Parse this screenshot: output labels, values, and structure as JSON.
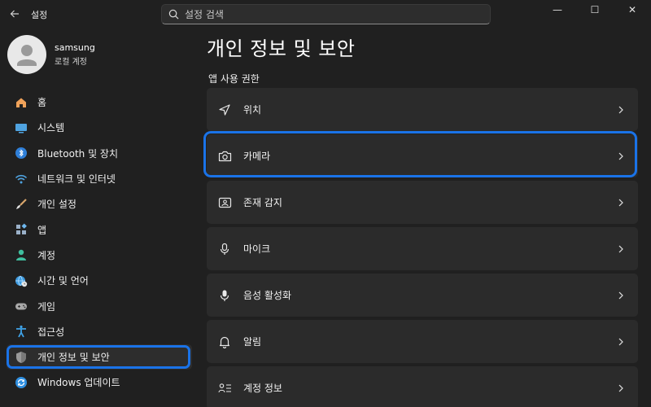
{
  "window": {
    "title": "설정",
    "minimize": "—",
    "maximize": "☐",
    "close": "✕"
  },
  "search": {
    "placeholder": "설정 검색"
  },
  "profile": {
    "name": "samsung",
    "account_type": "로컬 계정"
  },
  "sidebar": {
    "items": [
      {
        "label": "홈",
        "icon": "home-icon"
      },
      {
        "label": "시스템",
        "icon": "monitor-icon"
      },
      {
        "label": "Bluetooth 및 장치",
        "icon": "bluetooth-icon"
      },
      {
        "label": "네트워크 및 인터넷",
        "icon": "wifi-icon"
      },
      {
        "label": "개인 설정",
        "icon": "brush-icon"
      },
      {
        "label": "앱",
        "icon": "apps-icon"
      },
      {
        "label": "계정",
        "icon": "person-icon"
      },
      {
        "label": "시간 및 언어",
        "icon": "globe-clock-icon"
      },
      {
        "label": "게임",
        "icon": "gamepad-icon"
      },
      {
        "label": "접근성",
        "icon": "accessibility-icon"
      },
      {
        "label": "개인 정보 및 보안",
        "icon": "shield-icon",
        "active": true
      },
      {
        "label": "Windows 업데이트",
        "icon": "sync-icon"
      }
    ]
  },
  "main": {
    "title": "개인 정보 및 보안",
    "section": "앱 사용 권한",
    "rows": [
      {
        "label": "위치",
        "icon": "location-arrow-icon"
      },
      {
        "label": "카메라",
        "icon": "camera-icon"
      },
      {
        "label": "존재 감지",
        "icon": "presence-icon"
      },
      {
        "label": "마이크",
        "icon": "microphone-icon"
      },
      {
        "label": "음성 활성화",
        "icon": "voice-microphone-icon"
      },
      {
        "label": "알림",
        "icon": "bell-icon"
      },
      {
        "label": "계정 정보",
        "icon": "account-info-icon"
      }
    ]
  },
  "colors": {
    "background": "#202020",
    "card": "#2b2b2b",
    "accent": "#4cc2ff",
    "highlight_outline": "#1a73e8"
  }
}
